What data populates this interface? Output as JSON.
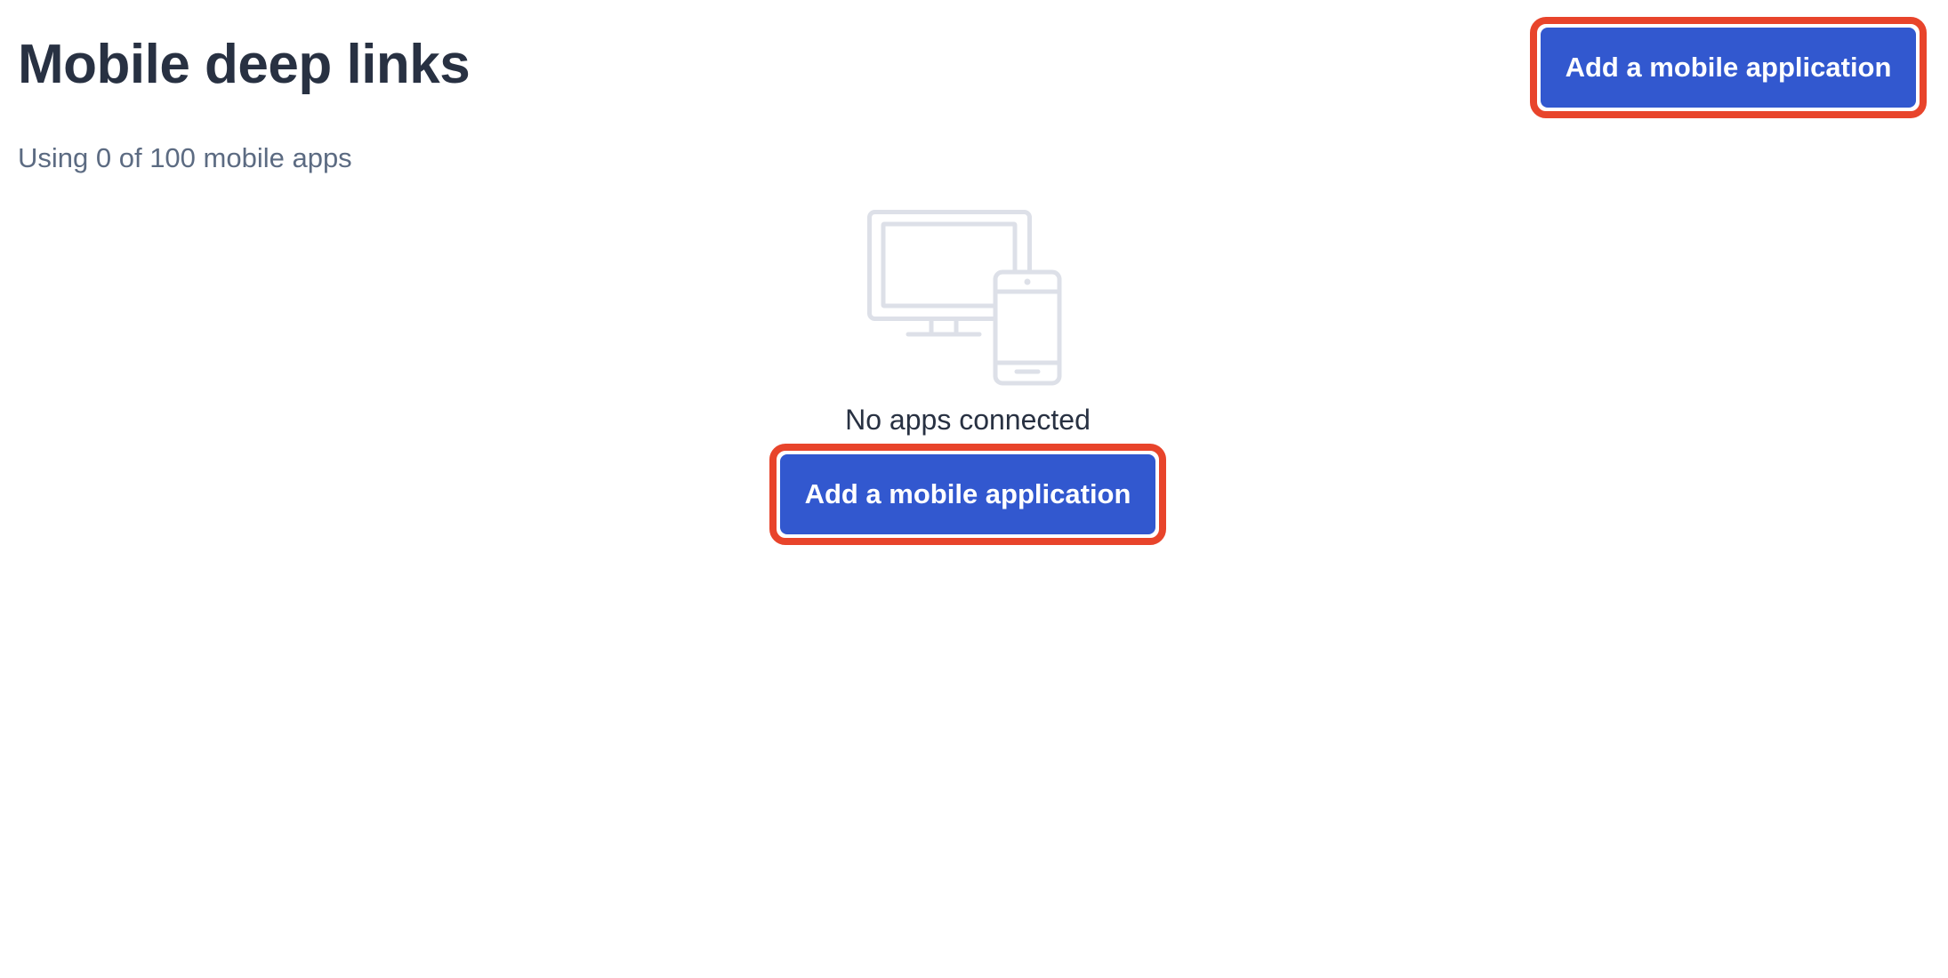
{
  "header": {
    "title": "Mobile deep links",
    "usage": "Using 0 of 100 mobile apps",
    "add_button_label": "Add a mobile application"
  },
  "empty_state": {
    "illustration_icon": "devices-icon",
    "message": "No apps connected",
    "add_button_label": "Add a mobile application"
  },
  "colors": {
    "primary": "#3258cf",
    "highlight": "#e8442b",
    "title": "#283142",
    "muted": "#5c6b82",
    "illustration": "#dde0e8"
  }
}
